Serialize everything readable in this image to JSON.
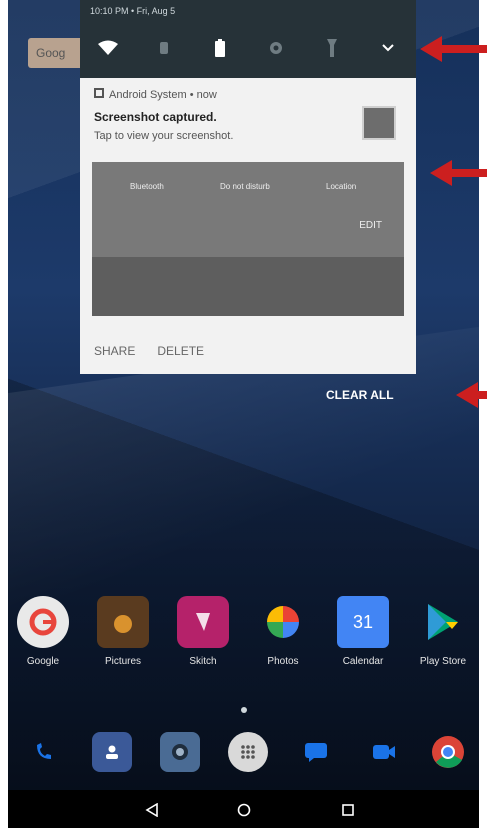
{
  "status_bar": {
    "text": "10:10 PM • Fri, Aug 5"
  },
  "quick_settings": {
    "tiles": [
      "wifi-icon",
      "bluetooth-icon",
      "battery-icon",
      "settings-icon",
      "flashlight-icon",
      "expand-chevron-icon"
    ]
  },
  "home_search": {
    "label": "Goog"
  },
  "notification": {
    "app_name": "Android System • now",
    "title": "Screenshot captured.",
    "text": "Tap to view your screenshot.",
    "image_labels": [
      "Bluetooth",
      "Do not disturb",
      "Location"
    ],
    "image_edit": "EDIT",
    "actions": [
      "SHARE",
      "DELETE"
    ]
  },
  "clear_all": "CLEAR ALL",
  "apps": [
    {
      "label": "Google",
      "icon": "google-icon",
      "color": "#e8453c"
    },
    {
      "label": "Pictures",
      "icon": "pictures-icon",
      "color": "#8a5a2b"
    },
    {
      "label": "Skitch",
      "icon": "skitch-icon",
      "color": "#b5226a"
    },
    {
      "label": "Photos",
      "icon": "photos-icon",
      "color": "#f4b400"
    },
    {
      "label": "Calendar",
      "icon": "calendar-icon",
      "color": "#4285f4"
    },
    {
      "label": "Play Store",
      "icon": "play-store-icon",
      "color": "#00a173"
    }
  ],
  "dock": [
    "phone-icon",
    "contacts-icon",
    "camera-icon",
    "app-drawer-icon",
    "messages-icon",
    "duo-icon",
    "chrome-icon"
  ],
  "navbar": [
    "back-icon",
    "home-icon",
    "recents-icon"
  ],
  "colors": {
    "accent_arrow": "#cc1f1f",
    "qs_background": "#263238",
    "notification_background": "#f2f2f2"
  }
}
